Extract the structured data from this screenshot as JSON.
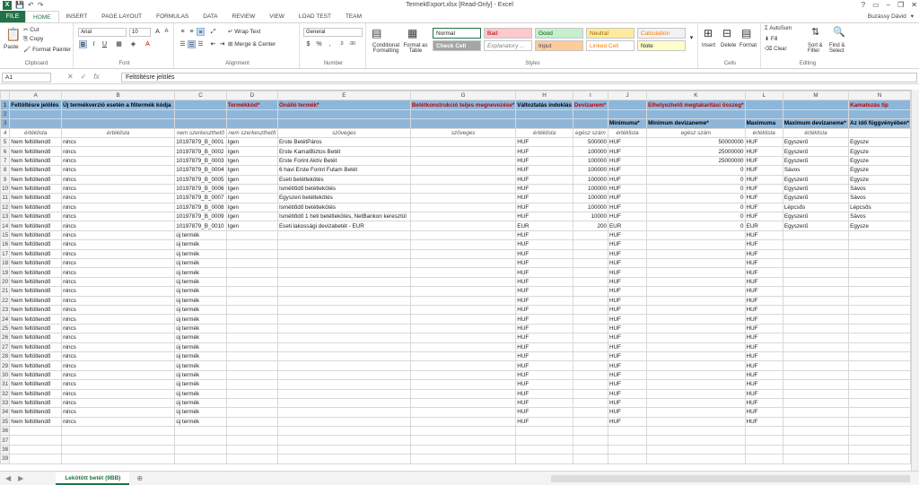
{
  "window": {
    "title": "TermekExport.xlsx  [Read-Only] - Excel",
    "user": "Buzássy Dávid",
    "controls": [
      "?",
      "▭",
      "–",
      "❐",
      "✕"
    ]
  },
  "tabs": [
    "FILE",
    "HOME",
    "INSERT",
    "PAGE LAYOUT",
    "FORMULAS",
    "DATA",
    "REVIEW",
    "VIEW",
    "LOAD TEST",
    "TEAM"
  ],
  "ribbon": {
    "clipboard": {
      "label": "Clipboard",
      "paste": "Paste",
      "cut": "Cut",
      "copy": "Copy",
      "format_painter": "Format Painter"
    },
    "font": {
      "label": "Font",
      "name": "Arial",
      "size": "10"
    },
    "alignment": {
      "label": "Alignment",
      "wrap": "Wrap Text",
      "merge": "Merge & Center"
    },
    "number": {
      "label": "Number",
      "format": "General"
    },
    "styles": {
      "label": "Styles",
      "conditional": "Conditional Formatting",
      "format_table": "Format as Table",
      "cells": [
        {
          "text": "Normal",
          "bg": "#ffffff",
          "fg": "#000000"
        },
        {
          "text": "Bad",
          "bg": "#ffc7ce",
          "fg": "#9c0006"
        },
        {
          "text": "Good",
          "bg": "#c6efce",
          "fg": "#006100"
        },
        {
          "text": "Neutral",
          "bg": "#ffeb9c",
          "fg": "#9c6500"
        },
        {
          "text": "Calculation",
          "bg": "#f2f2f2",
          "fg": "#fa7d00"
        },
        {
          "text": "Check Cell",
          "bg": "#a5a5a5",
          "fg": "#ffffff"
        },
        {
          "text": "Explanatory ...",
          "bg": "#ffffff",
          "fg": "#7f7f7f"
        },
        {
          "text": "Input",
          "bg": "#ffcc99",
          "fg": "#3f3f76"
        },
        {
          "text": "Linked Cell",
          "bg": "#ffffff",
          "fg": "#fa7d00"
        },
        {
          "text": "Note",
          "bg": "#ffffcc",
          "fg": "#000000"
        }
      ]
    },
    "cells_group": {
      "label": "Cells",
      "insert": "Insert",
      "delete": "Delete",
      "format": "Format"
    },
    "editing": {
      "label": "Editing",
      "autosum": "AutoSum",
      "fill": "Fill",
      "clear": "Clear",
      "sort": "Sort & Filter",
      "find": "Find & Select"
    }
  },
  "formula_bar": {
    "name_box": "A1",
    "content": "Feltöltésre jelölés"
  },
  "columns": [
    "A",
    "B",
    "C",
    "D",
    "E",
    "G",
    "H",
    "I",
    "J",
    "K",
    "L",
    "M",
    "N"
  ],
  "header_row1": [
    "Feltöltésre jelölés",
    "Új termékverzió esetén a főtermék kódja",
    "",
    "Termékkód*",
    "Önálló termék*",
    "Betétkonstrukció teljes megnevezése*",
    "Változtatás indoklás",
    "Devizanem*",
    "",
    "Elhelyezhető megtakarítási összeg*",
    "",
    "",
    "Kamatozás típ"
  ],
  "header_row3": [
    "",
    "",
    "",
    "",
    "",
    "",
    "",
    "",
    "Minimuma*",
    "Minimum devizaneme*",
    "Maximuma",
    "Maximum devizaneme*",
    "Az idő függvényében*",
    "Az öss"
  ],
  "type_row": [
    "értéklista",
    "értéklista",
    "nem szerkeszthető",
    "nem szerkeszthető",
    "szöveges",
    "szöveges",
    "értéklista",
    "egész szám",
    "értéklista",
    "egész szám",
    "értéklista",
    "értéklista",
    ""
  ],
  "rows": [
    [
      "Nem feltöltendő",
      "nincs",
      "10197879_B_0001",
      "Igen",
      "Erste BetétPáros",
      "",
      "HUF",
      "500000",
      "HUF",
      "50000000",
      "HUF",
      "Egyszerű",
      "Egysze"
    ],
    [
      "Nem feltöltendő",
      "nincs",
      "10197879_B_0002",
      "Igen",
      "Erste KamatBiztos Betét",
      "",
      "HUF",
      "100000",
      "HUF",
      "25000000",
      "HUF",
      "Egyszerű",
      "Egysze"
    ],
    [
      "Nem feltöltendő",
      "nincs",
      "10197879_B_0003",
      "Igen",
      "Erste Forint Aktív Betét",
      "",
      "HUF",
      "100000",
      "HUF",
      "25000000",
      "HUF",
      "Egyszerű",
      "Egysze"
    ],
    [
      "Nem feltöltendő",
      "nincs",
      "10197879_B_0004",
      "Igen",
      "6 havi Erste Forint Futam Betét",
      "",
      "HUF",
      "100000",
      "HUF",
      "0",
      "HUF",
      "Sávos",
      "Egysze"
    ],
    [
      "Nem feltöltendő",
      "nincs",
      "10197879_B_0005",
      "Igen",
      "Eseti betétlekötés",
      "",
      "HUF",
      "100000",
      "HUF",
      "0",
      "HUF",
      "Egyszerű",
      "Egysze"
    ],
    [
      "Nem feltöltendő",
      "nincs",
      "10197879_B_0006",
      "Igen",
      "Ismétlődő betétlekötés",
      "",
      "HUF",
      "100000",
      "HUF",
      "0",
      "HUF",
      "Egyszerű",
      "Sávos"
    ],
    [
      "Nem feltöltendő",
      "nincs",
      "10197879_B_0007",
      "Igen",
      "Egyszeri betétlekötés",
      "",
      "HUF",
      "100000",
      "HUF",
      "0",
      "HUF",
      "Egyszerű",
      "Sávos"
    ],
    [
      "Nem feltöltendő",
      "nincs",
      "10197879_B_0008",
      "Igen",
      "Ismétlődő betétlekötés",
      "",
      "HUF",
      "100000",
      "HUF",
      "0",
      "HUF",
      "Lépcsős",
      "Lépcsős"
    ],
    [
      "Nem feltöltendő",
      "nincs",
      "10197879_B_0009",
      "Igen",
      "Ismétlődő 1 heti betétlekötés, NetBankon keresztül",
      "",
      "HUF",
      "10000",
      "HUF",
      "0",
      "HUF",
      "Egyszerű",
      "Sávos"
    ],
    [
      "Nem feltöltendő",
      "nincs",
      "10197879_B_0010",
      "Igen",
      "Eseti lakossági devizabetét - EUR",
      "",
      "EUR",
      "200",
      "EUR",
      "0",
      "EUR",
      "Egyszerű",
      "Egysze"
    ]
  ],
  "new_row": {
    "a": "Nem feltöltendő",
    "b": "nincs",
    "d": "új termék",
    "i": "HUF",
    "k": "HUF",
    "m": "HUF"
  },
  "sheet_tab": "Lekötött betét (9BB)"
}
